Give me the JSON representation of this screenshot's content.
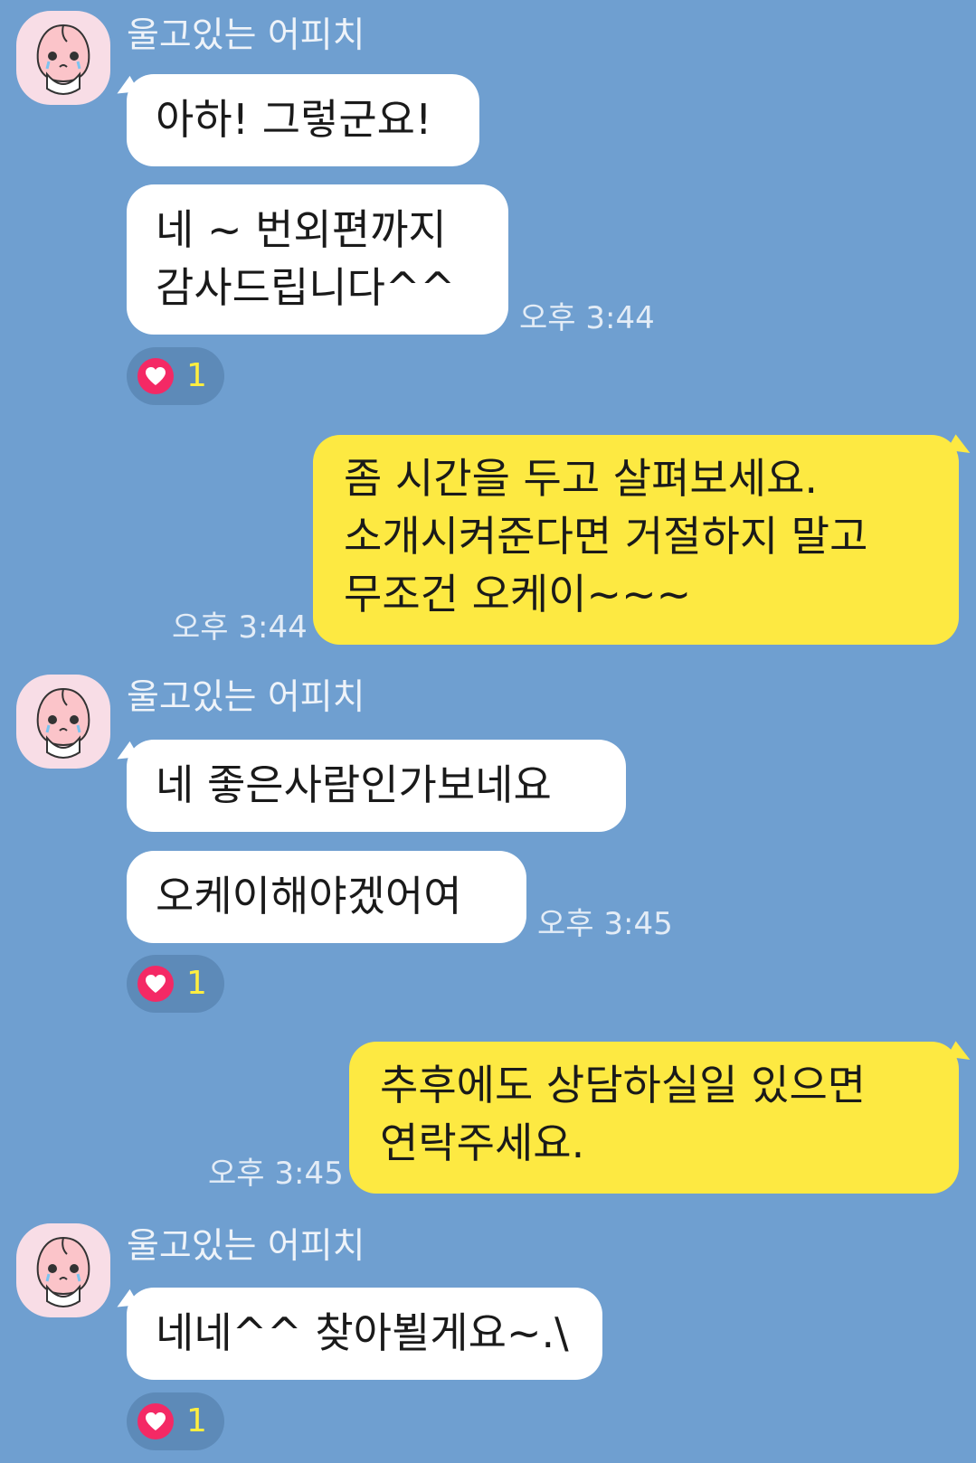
{
  "chat": {
    "messages": [
      {
        "sender": "울고있는 어피치",
        "texts": [
          "아하! 그렇군요!",
          "네 ~ 번외편까지\n감사드립니다^^"
        ],
        "time": "오후 3:44",
        "reaction": {
          "icon": "heart-icon",
          "count": "1"
        }
      },
      {
        "text": "좀 시간을 두고 살펴보세요.\n소개시켜준다면 거절하지 말고\n무조건  오케이~~~",
        "time": "오후 3:44"
      },
      {
        "sender": "울고있는 어피치",
        "texts": [
          "네 좋은사람인가보네요",
          "오케이해야겠어여"
        ],
        "time": "오후 3:45",
        "reaction": {
          "icon": "heart-icon",
          "count": "1"
        }
      },
      {
        "text": "추후에도 상담하실일 있으면\n연락주세요.",
        "time": "오후 3:45"
      },
      {
        "sender": "울고있는 어피치",
        "texts": [
          "네네^^ 찾아뵐게요~.\\"
        ],
        "reaction": {
          "icon": "heart-icon",
          "count": "1"
        }
      }
    ]
  },
  "colors": {
    "background": "#6f9fd0",
    "incoming_bubble": "#ffffff",
    "outgoing_bubble": "#fde942",
    "reaction_pill": "#5d8ab8",
    "heart": "#f42965",
    "reaction_count": "#ffee40",
    "avatar_bg": "#f8dde6"
  }
}
